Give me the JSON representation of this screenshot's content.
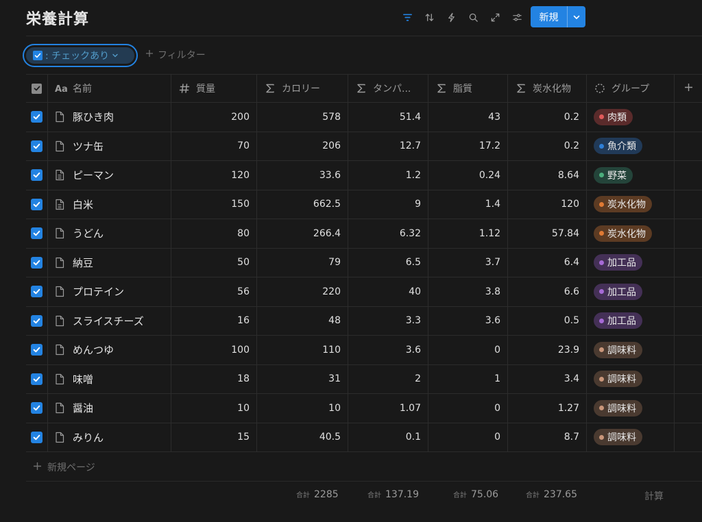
{
  "page": {
    "title": "栄養計算"
  },
  "toolbar": {
    "icons": [
      "filter-icon",
      "sort-icon",
      "automation-icon",
      "search-icon",
      "expand-icon",
      "settings-icon"
    ],
    "new_label": "新規",
    "accent": "#2383e2"
  },
  "filter": {
    "active_label": ": チェックあり",
    "add_label": "フィルター"
  },
  "columns": {
    "name": "名前",
    "mass": "質量",
    "calories": "カロリー",
    "protein": "タンパ...",
    "fat": "脂質",
    "carbs": "炭水化物",
    "group": "グループ"
  },
  "rows": [
    {
      "name": "豚ひき肉",
      "mass": "200",
      "calories": "578",
      "protein": "51.4",
      "fat": "43",
      "carbs": "0.2",
      "group": "肉類",
      "group_bg": "#5a2b2b",
      "group_dot": "#e05a5a"
    },
    {
      "name": "ツナ缶",
      "mass": "70",
      "calories": "206",
      "protein": "12.7",
      "fat": "17.2",
      "carbs": "0.2",
      "group": "魚介類",
      "group_bg": "#213a58",
      "group_dot": "#2f7fd6"
    },
    {
      "name": "ピーマン",
      "mass": "120",
      "calories": "33.6",
      "protein": "1.2",
      "fat": "0.24",
      "carbs": "8.64",
      "group": "野菜",
      "group_bg": "#24443a",
      "group_dot": "#4caf7d"
    },
    {
      "name": "白米",
      "mass": "150",
      "calories": "662.5",
      "protein": "9",
      "fat": "1.4",
      "carbs": "120",
      "group": "炭水化物",
      "group_bg": "#5c3b23",
      "group_dot": "#e07a34"
    },
    {
      "name": "うどん",
      "mass": "80",
      "calories": "266.4",
      "protein": "6.32",
      "fat": "1.12",
      "carbs": "57.84",
      "group": "炭水化物",
      "group_bg": "#5c3b23",
      "group_dot": "#e07a34"
    },
    {
      "name": "納豆",
      "mass": "50",
      "calories": "79",
      "protein": "6.5",
      "fat": "3.7",
      "carbs": "6.4",
      "group": "加工品",
      "group_bg": "#443056",
      "group_dot": "#a66ad6"
    },
    {
      "name": "プロテイン",
      "mass": "56",
      "calories": "220",
      "protein": "40",
      "fat": "3.8",
      "carbs": "6.6",
      "group": "加工品",
      "group_bg": "#443056",
      "group_dot": "#a66ad6"
    },
    {
      "name": "スライスチーズ",
      "mass": "16",
      "calories": "48",
      "protein": "3.3",
      "fat": "3.6",
      "carbs": "0.5",
      "group": "加工品",
      "group_bg": "#443056",
      "group_dot": "#a66ad6"
    },
    {
      "name": "めんつゆ",
      "mass": "100",
      "calories": "110",
      "protein": "3.6",
      "fat": "0",
      "carbs": "23.9",
      "group": "調味料",
      "group_bg": "#4a3a30",
      "group_dot": "#c9967a"
    },
    {
      "name": "味噌",
      "mass": "18",
      "calories": "31",
      "protein": "2",
      "fat": "1",
      "carbs": "3.4",
      "group": "調味料",
      "group_bg": "#4a3a30",
      "group_dot": "#c9967a"
    },
    {
      "name": "醤油",
      "mass": "10",
      "calories": "10",
      "protein": "1.07",
      "fat": "0",
      "carbs": "1.27",
      "group": "調味料",
      "group_bg": "#4a3a30",
      "group_dot": "#c9967a"
    },
    {
      "name": "みりん",
      "mass": "15",
      "calories": "40.5",
      "protein": "0.1",
      "fat": "0",
      "carbs": "8.7",
      "group": "調味料",
      "group_bg": "#4a3a30",
      "group_dot": "#c9967a"
    }
  ],
  "footer": {
    "new_page_label": "新規ページ",
    "sum_label": "合計",
    "sum_calories": "2285",
    "sum_protein": "137.19",
    "sum_fat": "75.06",
    "sum_carbs": "237.65",
    "calc_label": "計算"
  }
}
